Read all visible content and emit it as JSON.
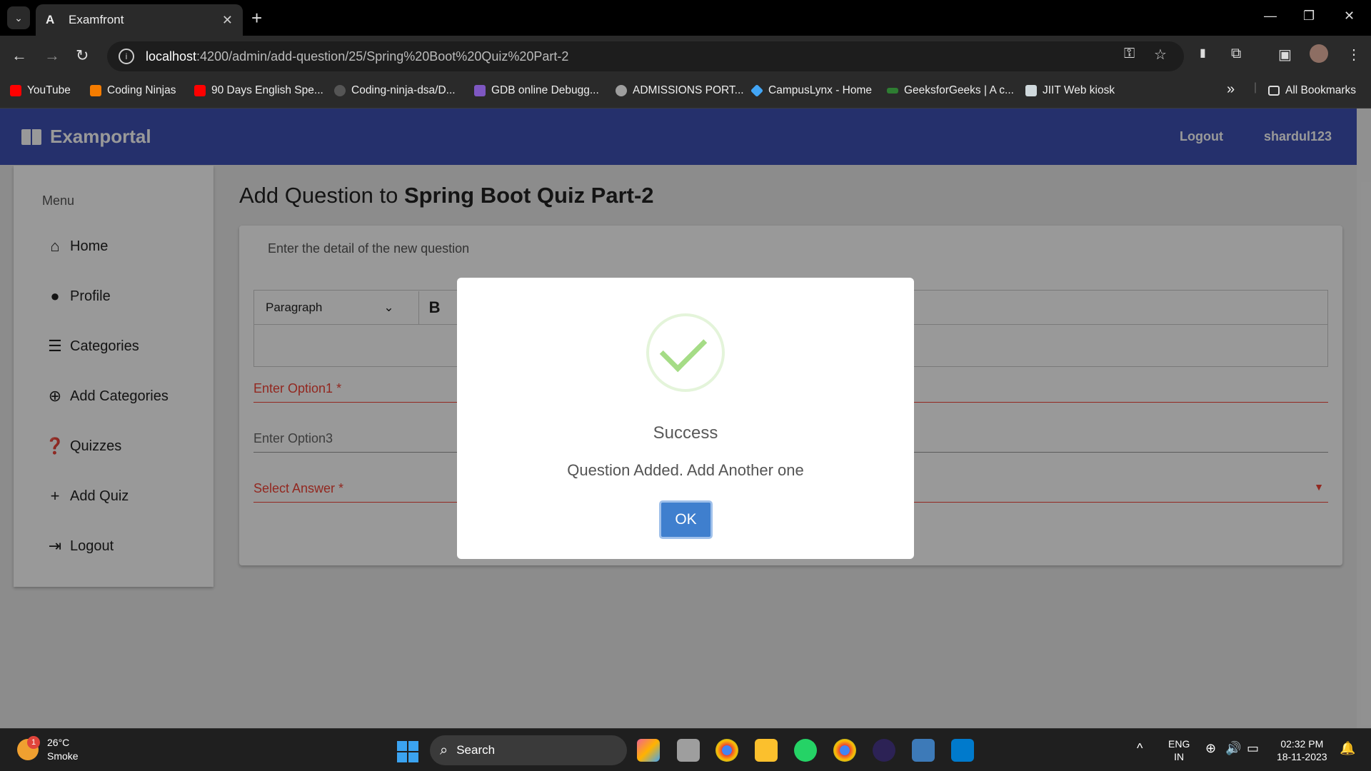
{
  "browser": {
    "tab_title": "Examfront",
    "tab_favicon": "A",
    "url_host": "localhost",
    "url_path": ":4200/admin/add-question/25/Spring%20Boot%20Quiz%20Part-2",
    "bookmarks": [
      {
        "label": "YouTube",
        "color": "#ff0000"
      },
      {
        "label": "Coding Ninjas",
        "color": "#f57c00"
      },
      {
        "label": "90 Days English Spe...",
        "color": "#ff0000"
      },
      {
        "label": "Coding-ninja-dsa/D...",
        "color": "#555555"
      },
      {
        "label": "GDB online Debugg...",
        "color": "#7e57c2"
      },
      {
        "label": "ADMISSIONS PORT...",
        "color": "#9e9e9e"
      },
      {
        "label": "CampusLynx - Home",
        "color": "#42a5f5"
      },
      {
        "label": "GeeksforGeeks | A c...",
        "color": "#2e7d32"
      },
      {
        "label": "JIIT Web kiosk",
        "color": "#cfd8dc"
      }
    ],
    "all_bookmarks": "All Bookmarks"
  },
  "header": {
    "brand": "Examportal",
    "logout": "Logout",
    "username": "shardul123"
  },
  "sidebar": {
    "title": "Menu",
    "items": [
      {
        "label": "Home",
        "icon": "home-icon"
      },
      {
        "label": "Profile",
        "icon": "account-icon"
      },
      {
        "label": "Categories",
        "icon": "list-icon"
      },
      {
        "label": "Add Categories",
        "icon": "add-circle-icon"
      },
      {
        "label": "Quizzes",
        "icon": "quiz-icon"
      },
      {
        "label": "Add Quiz",
        "icon": "plus-icon"
      },
      {
        "label": "Logout",
        "icon": "logout-icon"
      }
    ]
  },
  "main": {
    "title_prefix": "Add Question to ",
    "quiz_name": "Spring Boot Quiz Part-2",
    "card_subtitle": "Enter the detail of the new question",
    "editor_format": "Paragraph",
    "option1_placeholder": "Enter Option1 *",
    "option3_placeholder": "Enter Option3",
    "answer_placeholder": "Select Answer *"
  },
  "dialog": {
    "title": "Success",
    "message": "Question Added. Add Another one",
    "ok": "OK"
  },
  "taskbar": {
    "temperature": "26°C",
    "condition": "Smoke",
    "weather_badge": "1",
    "search": "Search",
    "lang_top": "ENG",
    "lang_bottom": "IN",
    "time": "02:32 PM",
    "date": "18-11-2023"
  }
}
